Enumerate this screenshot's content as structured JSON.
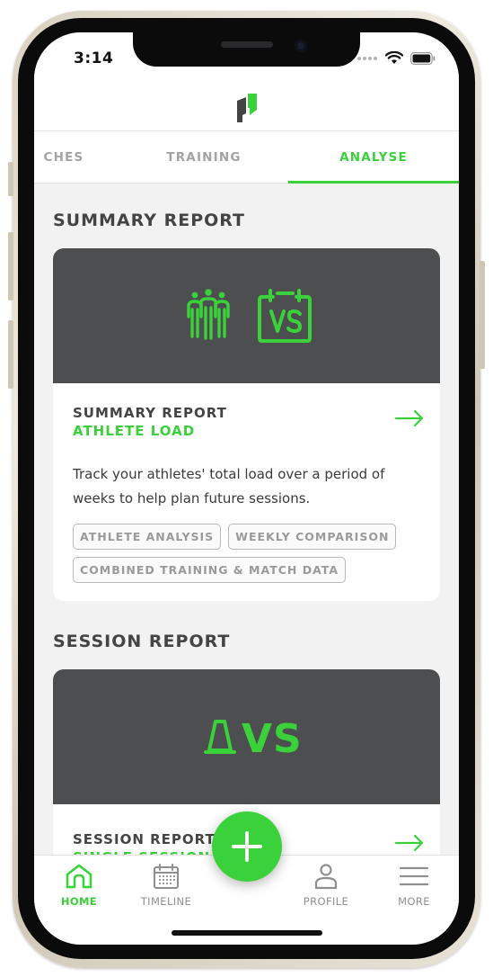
{
  "status_bar": {
    "time": "3:14"
  },
  "tabs": [
    {
      "label": "CHES",
      "active": false
    },
    {
      "label": "TRAINING",
      "active": false
    },
    {
      "label": "ANALYSE",
      "active": true
    }
  ],
  "sections": [
    {
      "title": "SUMMARY REPORT",
      "card": {
        "hero_icons": [
          "athletes-group-icon",
          "calendar-vs-icon"
        ],
        "kicker": "SUMMARY REPORT",
        "subtitle": "ATHLETE LOAD",
        "description": "Track your athletes' total load over a period of weeks to help plan future sessions.",
        "chips": [
          "ATHLETE ANALYSIS",
          "WEEKLY COMPARISON",
          "COMBINED TRAINING & MATCH DATA"
        ]
      }
    },
    {
      "title": "SESSION REPORT",
      "card": {
        "hero_icons": [
          "cone-icon",
          "vs-text-icon"
        ],
        "hero_text": "VS",
        "kicker": "SESSION REPORT",
        "subtitle": "SINGLE SESSION A"
      }
    }
  ],
  "bottom_nav": [
    {
      "label": "HOME",
      "icon": "home-icon",
      "active": true
    },
    {
      "label": "TIMELINE",
      "icon": "calendar-icon",
      "active": false
    },
    {
      "label": "PROFILE",
      "icon": "person-icon",
      "active": false
    },
    {
      "label": "MORE",
      "icon": "menu-icon",
      "active": false
    }
  ],
  "fab": {
    "icon": "plus-icon"
  },
  "colors": {
    "accent": "#3ad13a",
    "hero_bg": "#4d4e50",
    "page_bg": "#f2f2f2"
  }
}
